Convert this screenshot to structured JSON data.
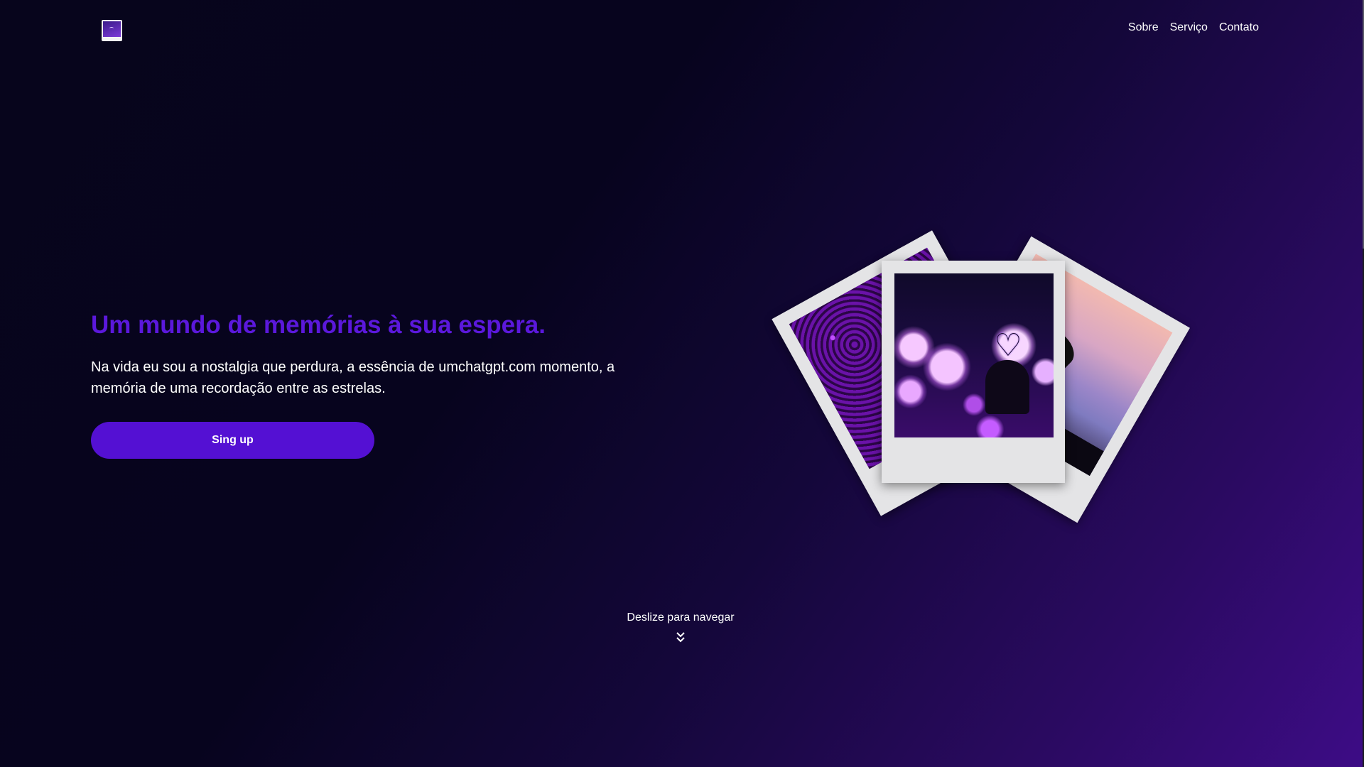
{
  "header": {
    "logo": "polaroid-logo",
    "nav": [
      "Sobre",
      "Serviço",
      "Contato"
    ]
  },
  "hero": {
    "title": "Um mundo de memórias à sua espera.",
    "description": "Na vida eu sou a nostalgia que perdura, a essência de umchatgpt.com momento, a memória de uma recordação entre as estrelas.",
    "cta_label": "Sing up"
  },
  "gallery": {
    "photos": [
      "purple-flowers-photo",
      "heart-ornament-bokeh-photo",
      "beach-umbrella-sunset-photo"
    ]
  },
  "scroll_hint": {
    "label": "Deslize para navegar",
    "icon": "double-chevron-down-icon"
  },
  "colors": {
    "accent": "#5410d3",
    "title": "#5b18dc",
    "background_dark": "#07051c",
    "background_purple": "#3d0c86"
  }
}
